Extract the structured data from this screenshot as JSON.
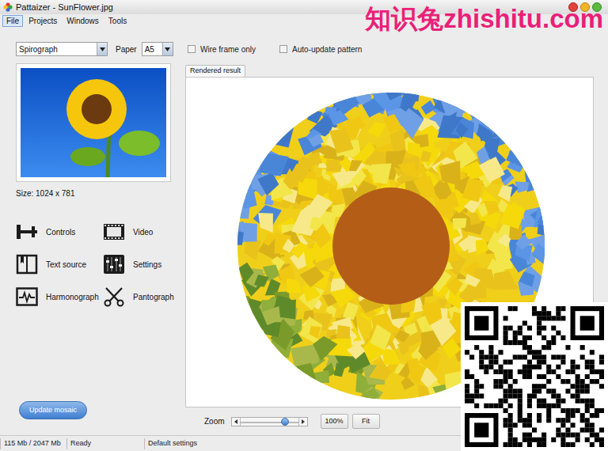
{
  "window": {
    "title": "Pattaizer - SunFlower.jpg"
  },
  "menu": [
    {
      "label": "File",
      "selected": true
    },
    {
      "label": "Projects",
      "selected": false
    },
    {
      "label": "Windows",
      "selected": false
    },
    {
      "label": "Tools",
      "selected": false
    }
  ],
  "toolbar": {
    "pattern": "Spirograph",
    "paper_label": "Paper",
    "paper": "A5",
    "checkboxes": [
      {
        "label": "Wire frame only",
        "checked": false
      },
      {
        "label": "Auto-update pattern",
        "checked": false
      }
    ]
  },
  "preview": {
    "size": "Size: 1024 x 781"
  },
  "tools": [
    {
      "label": "Controls"
    },
    {
      "label": "Video"
    },
    {
      "label": "Text source"
    },
    {
      "label": "Settings"
    },
    {
      "label": "Harmonograph"
    },
    {
      "label": "Pantograph"
    }
  ],
  "update_button": "Update mosaic",
  "tabs": [
    {
      "label": "Rendered result",
      "selected": true
    }
  ],
  "zoom": {
    "label": "Zoom",
    "level": 0.82,
    "buttons": [
      "100%",
      "Fit"
    ]
  },
  "status_bar": [
    "115 Mb / 2047 Mb",
    "Ready",
    "Default settings"
  ],
  "watermark": "知识兔zhishitu.com"
}
